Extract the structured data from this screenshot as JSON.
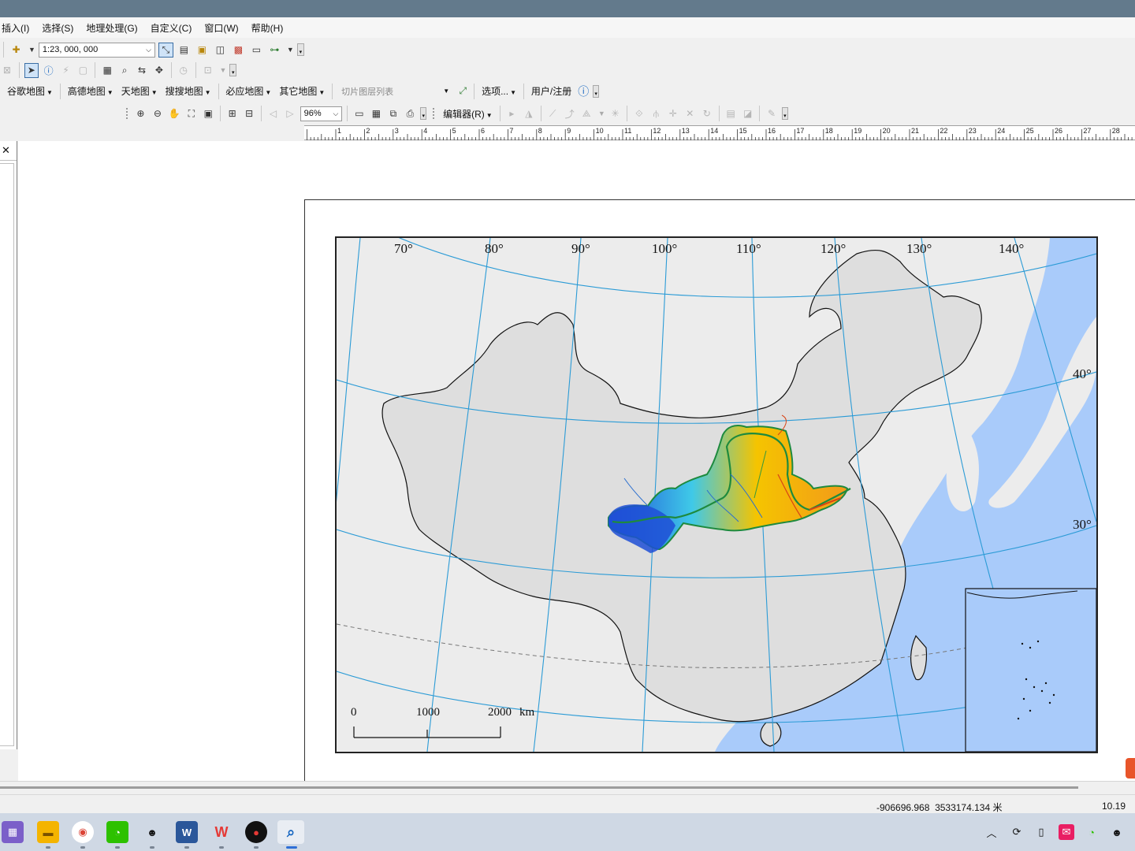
{
  "menubar": {
    "items": [
      "插入(I)",
      "选择(S)",
      "地理处理(G)",
      "自定义(C)",
      "窗口(W)",
      "帮助(H)"
    ]
  },
  "toolbar_standard": {
    "scale": "1:23, 000, 000"
  },
  "toolbar_basemaps": {
    "items": [
      "谷歌地图",
      "高德地图",
      "天地图",
      "搜搜地图",
      "必应地图",
      "其它地图"
    ],
    "tile_layer_placeholder": "切片图层列表",
    "options_label": "选项...",
    "user_label": "用户/注册"
  },
  "toolbar_layout": {
    "zoom_value": "96%",
    "editor_label": "编辑器(R)"
  },
  "ruler": {
    "labels": [
      "1",
      "2",
      "3",
      "4",
      "5",
      "6",
      "7",
      "8",
      "9",
      "10",
      "11",
      "12",
      "13",
      "14",
      "15",
      "16",
      "17",
      "18",
      "19",
      "20",
      "21",
      "22",
      "23",
      "24",
      "25",
      "26",
      "27",
      "28"
    ]
  },
  "left_panel": {
    "close_glyph": "✕"
  },
  "map": {
    "longitude_labels": [
      "70°",
      "80°",
      "90°",
      "100°",
      "110°",
      "120°",
      "130°",
      "140°"
    ],
    "latitude_labels": [
      "40°",
      "30°"
    ],
    "scale_bar": {
      "labels": [
        "0",
        "1000",
        "2000"
      ],
      "unit": "km"
    },
    "colors": {
      "ocean": "#a9cbfa",
      "land_china": "#dedede",
      "land_other": "#ececec",
      "graticule": "#2b9bd6",
      "basin_low": "#1f4fd6",
      "basin_mid": "#3fc9e8",
      "basin_high": "#f5c400",
      "river_main": "#1e8a3e"
    }
  },
  "statusbar": {
    "coordinates": "-906696.968  3533174.134 米",
    "page_units": "10.19"
  },
  "taskbar": {
    "apps": [
      "app-launcher",
      "file-explorer",
      "chrome",
      "wechat",
      "qq",
      "word",
      "wps",
      "recorder",
      "arcmap"
    ],
    "tray": [
      "chevron-up",
      "sync",
      "battery",
      "notification",
      "wechat",
      "qq"
    ]
  }
}
